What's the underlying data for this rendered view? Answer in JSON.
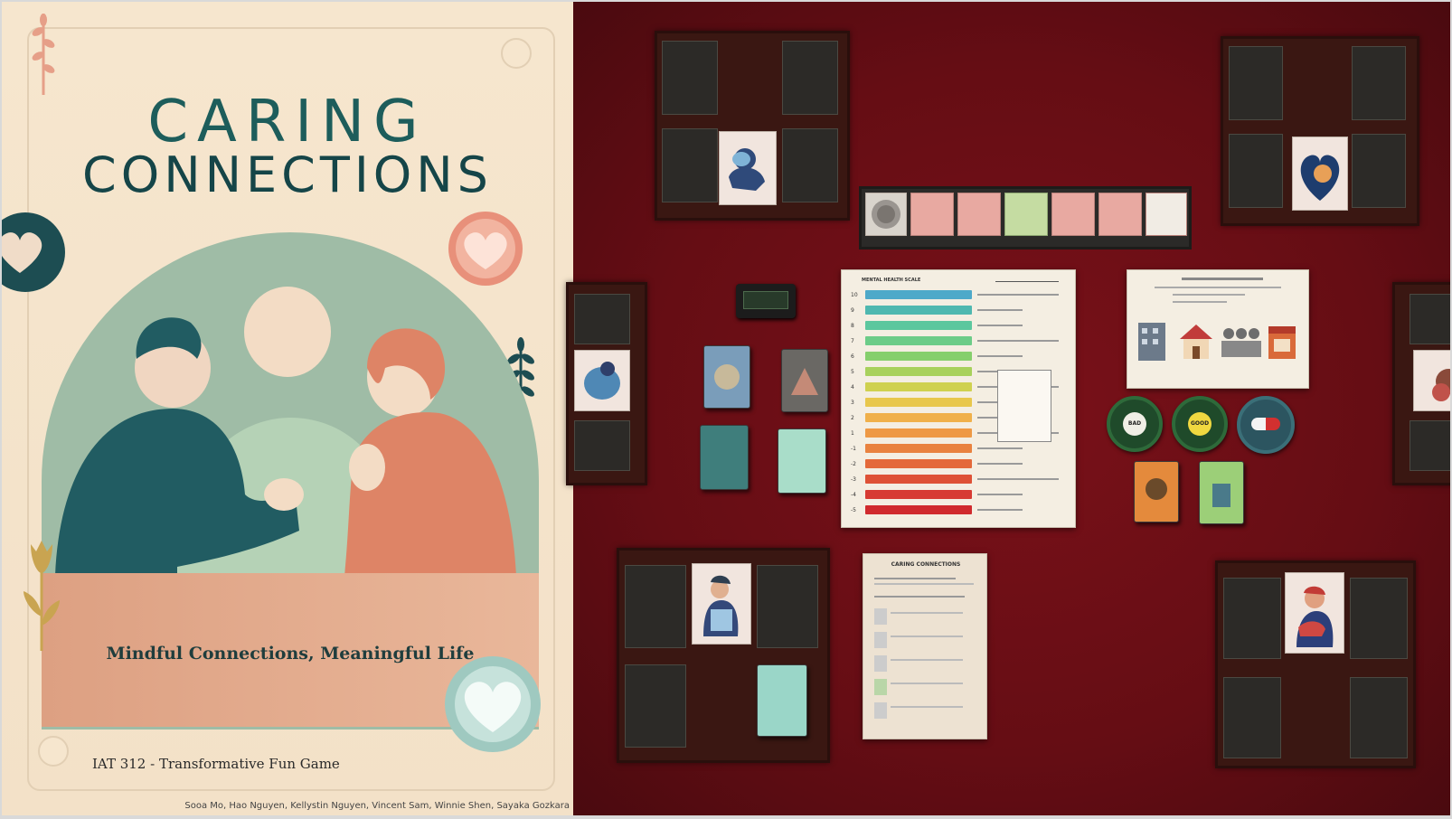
{
  "poster": {
    "title_line1": "CARING",
    "title_line2": "CONNECTIONS",
    "tagline": "Mindful Connections, Meaningful Life",
    "course": "IAT 312 - Transformative Fun Game",
    "authors": "Sooa Mo, Hao Nguyen, Kellystin Nguyen, Vincent Sam, Winnie Shen, Sayaka Gozkara",
    "colors": {
      "background": "#f6e6ce",
      "title": "#1d5d5b",
      "arch": "#9fbca6",
      "band": "#dda082",
      "teal": "#1f5a5e",
      "coral": "#de8466"
    }
  },
  "table": {
    "felt_color": "#6b0e15",
    "rules_sheet_title": "CARING CONNECTIONS",
    "mental_health_sheet_title": "MENTAL HEALTH SCALE",
    "mental_health_levels": [
      "10",
      "9",
      "8",
      "7",
      "6",
      "5",
      "4",
      "3",
      "2",
      "1",
      "-1",
      "-2",
      "-3",
      "-4",
      "-5"
    ],
    "mental_health_colors": [
      "#4ea9c9",
      "#4fb8b0",
      "#5cc79e",
      "#6ccc88",
      "#85cf6c",
      "#a8d15c",
      "#cfd14f",
      "#e8c74c",
      "#f0b04a",
      "#ee9945",
      "#e9823f",
      "#e4693a",
      "#de5136",
      "#d73b33",
      "#d02a2e"
    ],
    "token_labels": [
      "BAD",
      "GOOD",
      "PILL"
    ]
  }
}
